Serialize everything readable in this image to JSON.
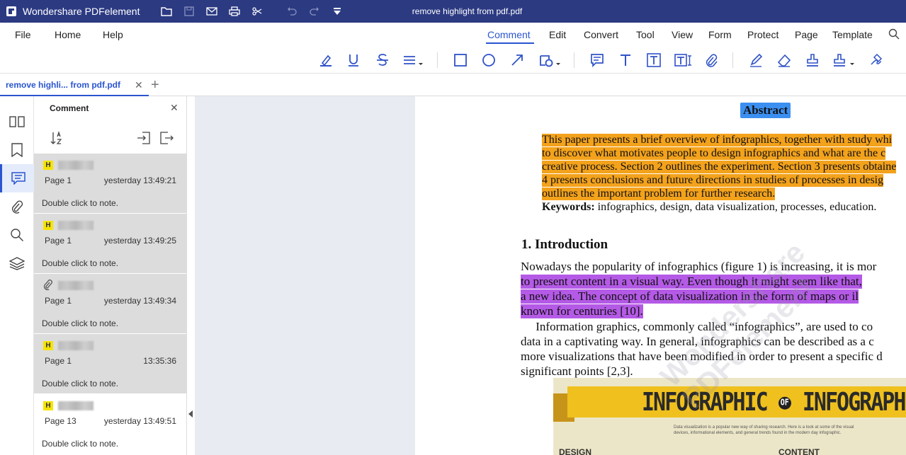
{
  "app": {
    "name": "Wondershare PDFelement",
    "document_title": "remove highlight from pdf.pdf"
  },
  "menu": {
    "left": [
      "File",
      "Home",
      "Help"
    ],
    "right": [
      "Comment",
      "Edit",
      "Convert",
      "Tool",
      "View",
      "Form",
      "Protect",
      "Page",
      "Template"
    ],
    "active": "Comment"
  },
  "tabs": {
    "doc_tab_label": "remove  highli... from pdf.pdf",
    "close_glyph": "✕",
    "add_glyph": "+"
  },
  "panel": {
    "title": "Comment",
    "close_glyph": "✕",
    "comments": [
      {
        "type": "H",
        "page": "Page 1",
        "time": "yesterday 13:49:21",
        "note": "Double click to note."
      },
      {
        "type": "H",
        "page": "Page 1",
        "time": "yesterday 13:49:25",
        "note": "Double click to note."
      },
      {
        "type": "attachment",
        "page": "Page 1",
        "time": "yesterday 13:49:34",
        "note": "Double click to note."
      },
      {
        "type": "H",
        "page": "Page 1",
        "time": "13:35:36",
        "note": "Double click to note."
      },
      {
        "type": "H",
        "page": "Page 13",
        "time": "yesterday 13:49:51",
        "note": "Double click to note."
      }
    ]
  },
  "document": {
    "abstract_title": "Abstract",
    "abstract_lines": [
      "This paper presents a brief overview of infographics, together with study whi",
      "to discover what motivates people to design infographics and what are the c",
      "creative process. Section 2 outlines the experiment. Section 3 presents obtaine",
      "4 presents conclusions and future directions in studies of processes in desig",
      "outlines the important problem for further research."
    ],
    "keywords_label": "Keywords:",
    "keywords_text": " infographics, design, data visualization, processes, education.",
    "intro_heading": "1.   Introduction",
    "intro_lines": [
      "Nowadays the popularity of infographics (figure 1) is increasing, it is mor",
      "to present content in a visual way. Even though it might seem like that,",
      "a new idea. The concept of data visualization in the form of maps or il",
      "known for centuries [10].",
      "     Information graphics, commonly called “infographics”, are used to co",
      "data in a captivating way. In general, infographics can be described as a c",
      "more visualizations that have been modified in order to present a specific d",
      "significant points [2,3]."
    ],
    "infographic": {
      "title_left": "INFOGRAPHIC",
      "title_of": "OF",
      "title_right": "INFOGRAPHICS",
      "subtitle": "Data visualization is a popular new way of sharing research. Here is a look at some of the visual devices, informational elements, and general trends found in the modern day infographic.",
      "label_design": "DESIGN",
      "label_content": "CONTENT"
    },
    "watermark": "Wondershare\nPDFelement"
  },
  "colors": {
    "titlebar": "#2c3a82",
    "accent": "#2a55d0",
    "highlight_orange": "#f3a21c",
    "highlight_purple": "#b45ae6",
    "highlight_blue": "#3b8ff0"
  }
}
